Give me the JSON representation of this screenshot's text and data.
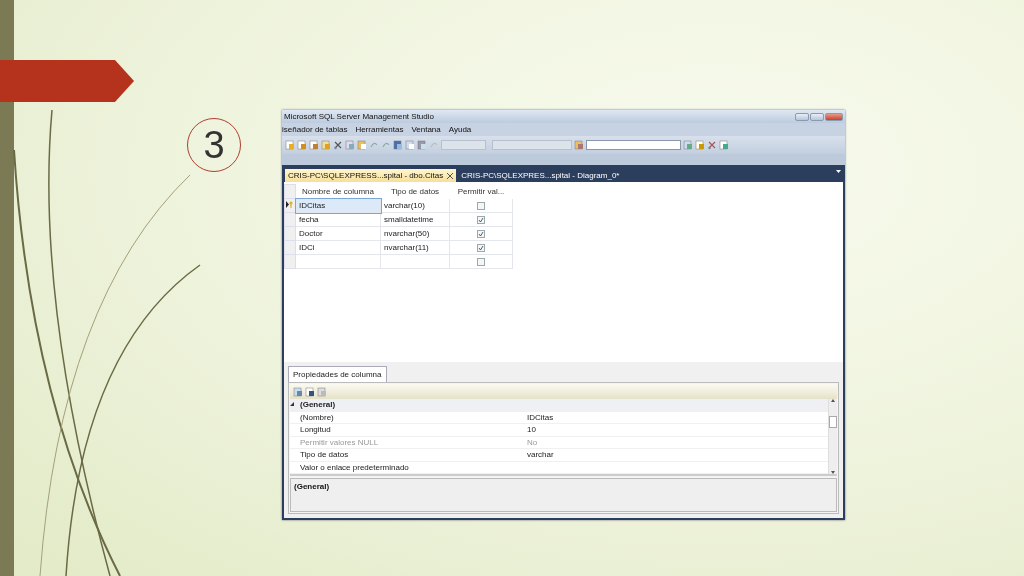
{
  "slide_number": "3",
  "window": {
    "title": "Microsoft SQL Server Management Studio"
  },
  "menu": [
    "iseñador de tablas",
    "Herramientas",
    "Ventana",
    "Ayuda"
  ],
  "tabs": [
    {
      "label": "CRIS-PC\\SQLEXPRESS...spital - dbo.Citas",
      "selected": true,
      "closable": true
    },
    {
      "label": "CRIS-PC\\SQLEXPRES...spital - Diagram_0*",
      "selected": false,
      "closable": false
    }
  ],
  "grid": {
    "columns": [
      "Nombre de columna",
      "Tipo de datos",
      "Permitir val..."
    ],
    "rows": [
      {
        "name": "IDCitas",
        "type": "varchar(10)",
        "allow_nulls": false,
        "current": true,
        "primary_key": true
      },
      {
        "name": "fecha",
        "type": "smalldatetime",
        "allow_nulls": true,
        "current": false,
        "primary_key": false
      },
      {
        "name": "Doctor",
        "type": "nvarchar(50)",
        "allow_nulls": true,
        "current": false,
        "primary_key": false
      },
      {
        "name": "IDCi",
        "type": "nvarchar(11)",
        "allow_nulls": true,
        "current": false,
        "primary_key": false
      },
      {
        "allow_nulls": false,
        "current": false,
        "primary_key": false
      }
    ]
  },
  "properties": {
    "tab": "Propiedades de columna",
    "category": "(General)",
    "expanded": true,
    "items": [
      {
        "name": "(Nombre)",
        "value": "IDCitas",
        "disabled": false
      },
      {
        "name": "Longitud",
        "value": "10",
        "disabled": false
      },
      {
        "name": "Permitir valores NULL",
        "value": "No",
        "disabled": true
      },
      {
        "name": "Tipo de datos",
        "value": "varchar",
        "disabled": false
      },
      {
        "name": "Valor o enlace predeterminado",
        "disabled": false
      }
    ],
    "description_title": "(General)"
  }
}
